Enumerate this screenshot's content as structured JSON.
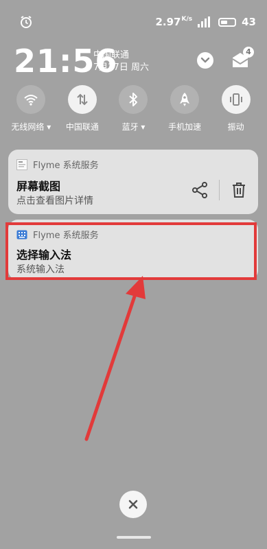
{
  "status_bar": {
    "net_speed": "2.97",
    "net_speed_unit": "K/s",
    "battery": "43"
  },
  "header": {
    "time": "21:56",
    "carrier": "中国联通",
    "date": "7月27日 周六",
    "notification_count": "4"
  },
  "quick_toggles": [
    {
      "label": "无线网络 ▾",
      "icon": "wifi-icon",
      "on": false
    },
    {
      "label": "中国联通",
      "icon": "mobile-data-icon",
      "on": true
    },
    {
      "label": "蓝牙 ▾",
      "icon": "bluetooth-icon",
      "on": false
    },
    {
      "label": "手机加速",
      "icon": "rocket-icon",
      "on": false
    },
    {
      "label": "振动",
      "icon": "vibrate-icon",
      "on": true
    }
  ],
  "notifications": [
    {
      "app": "Flyme 系统服务",
      "title": "屏幕截图",
      "subtitle": "点击查看图片详情"
    },
    {
      "app": "Flyme 系统服务",
      "title": "选择输入法",
      "subtitle": "系统输入法"
    }
  ],
  "colors": {
    "background": "#a2a2a2",
    "card": "#e2e2e2",
    "highlight": "#e23a3a"
  }
}
